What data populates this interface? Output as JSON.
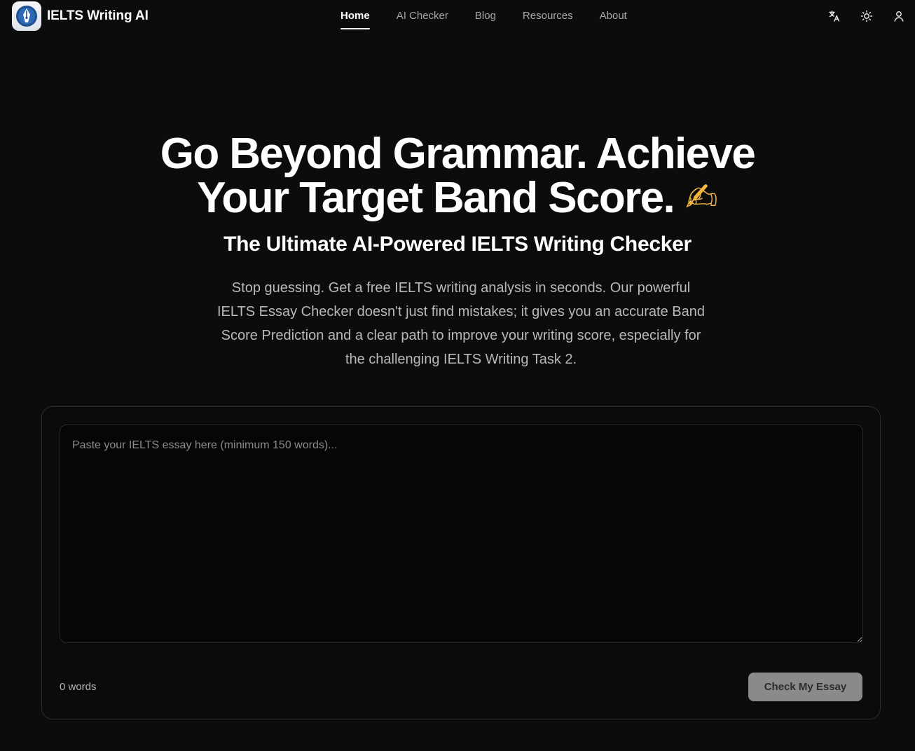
{
  "brand": {
    "name": "IELTS Writing AI",
    "logo_icon": "fountain-pen-icon"
  },
  "nav": {
    "items": [
      {
        "label": "Home",
        "active": true
      },
      {
        "label": "AI Checker",
        "active": false
      },
      {
        "label": "Blog",
        "active": false
      },
      {
        "label": "Resources",
        "active": false
      },
      {
        "label": "About",
        "active": false
      }
    ]
  },
  "tools": {
    "icons": [
      "translate-icon",
      "sun-icon",
      "user-icon"
    ]
  },
  "hero": {
    "title_line1": "Go Beyond Grammar. Achieve",
    "title_line2": "Your Target Band Score.",
    "title_emoji": "✍",
    "subtitle": "The Ultimate AI-Powered IELTS Writing Checker",
    "description": "Stop guessing. Get a free IELTS writing analysis in seconds. Our powerful IELTS Essay Checker doesn't just find mistakes; it gives you an accurate Band Score Prediction and a clear path to improve your writing score, especially for the challenging IELTS Writing Task 2."
  },
  "editor": {
    "placeholder": "Paste your IELTS essay here (minimum 150 words)...",
    "value": "",
    "word_count": "0 words",
    "submit_label": "Check My Essay"
  },
  "colors": {
    "background": "#0c0c0d",
    "text_primary": "#ffffff",
    "text_muted": "#b9b9bd",
    "button_disabled": "#8a8a8d"
  }
}
